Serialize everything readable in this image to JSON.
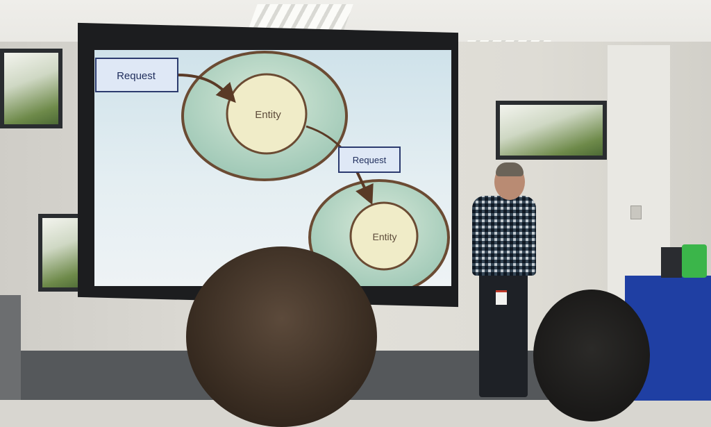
{
  "slide": {
    "request_label_1": "Request",
    "entity_label_1": "Entity",
    "request_label_2": "Request",
    "entity_label_2": "Entity"
  },
  "colors": {
    "label_box_fill": "#dfe8f6",
    "label_box_stroke": "#2b3a6e",
    "outer_circle_fill": "#b9d7c6",
    "inner_circle_fill": "#f0ecc8",
    "circle_stroke": "#6b4b33",
    "arrow": "#5a3a26",
    "lectern": "#1f3fa3"
  }
}
